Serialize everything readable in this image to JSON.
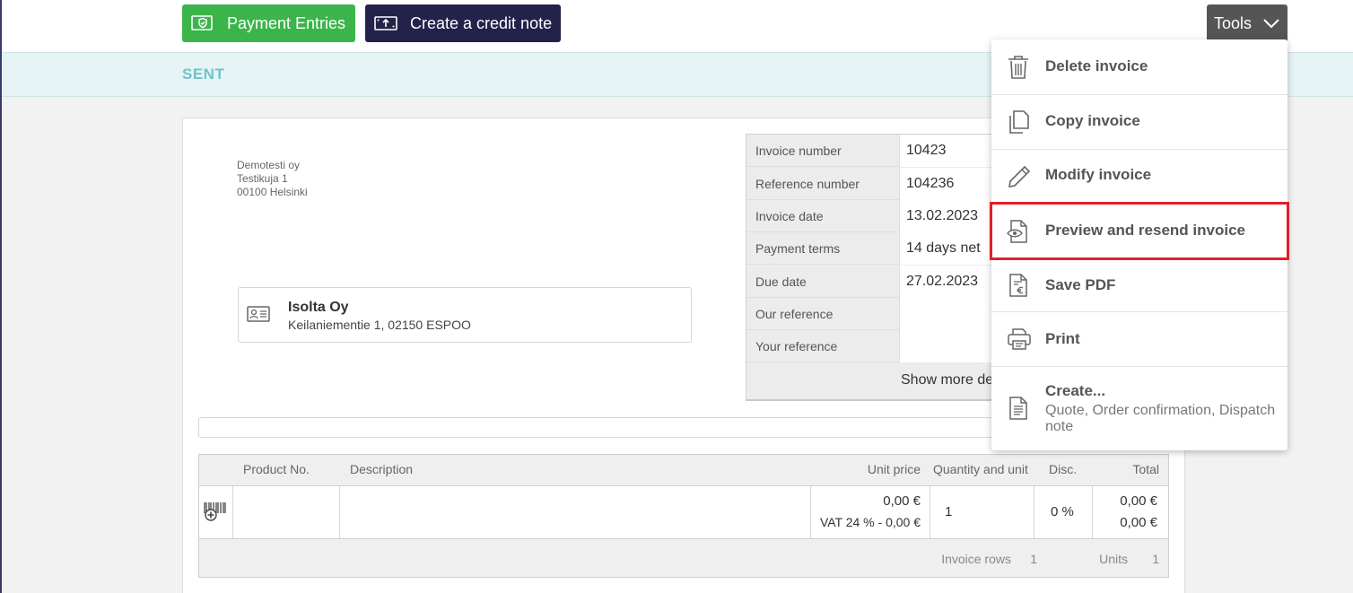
{
  "toolbar": {
    "payment_entries_label": "Payment Entries",
    "credit_note_label": "Create a credit note",
    "tools_label": "Tools"
  },
  "status": {
    "label": "SENT",
    "color": "#6cc4cc"
  },
  "sender": {
    "name": "Demotesti oy",
    "street": "Testikuja 1",
    "city": "00100 Helsinki"
  },
  "recipient": {
    "name": "Isolta Oy",
    "address": "Keilaniementie 1, 02150 ESPOO"
  },
  "invoice_meta": {
    "rows": [
      {
        "label": "Invoice number",
        "value": "10423"
      },
      {
        "label": "Reference number",
        "value": "104236"
      },
      {
        "label": "Invoice date",
        "value": "13.02.2023"
      },
      {
        "label": "Payment terms",
        "value": "14 days net"
      },
      {
        "label": "Due date",
        "value": "27.02.2023"
      },
      {
        "label": "Our reference",
        "value": ""
      },
      {
        "label": "Your reference",
        "value": ""
      }
    ],
    "show_more_label": "Show more de"
  },
  "rows_table": {
    "headers": {
      "product_no": "Product No.",
      "description": "Description",
      "unit_price": "Unit price",
      "quantity": "Quantity and unit",
      "disc": "Disc.",
      "total": "Total"
    },
    "row": {
      "unit_price": "0,00 €",
      "vat_line": "VAT 24 % - 0,00 €",
      "quantity": "1",
      "disc": "0 %",
      "total": "0,00 €",
      "total_vat": "0,00 €"
    },
    "footer": {
      "rows_label": "Invoice rows",
      "rows_count": "1",
      "units_label": "Units",
      "units_count": "1"
    }
  },
  "tools_menu": {
    "items": [
      {
        "label": "Delete invoice",
        "icon": "trash-icon"
      },
      {
        "label": "Copy invoice",
        "icon": "copy-icon"
      },
      {
        "label": "Modify invoice",
        "icon": "pencil-icon"
      },
      {
        "label": "Preview and resend invoice",
        "icon": "document-eye-icon"
      },
      {
        "label": "Save PDF",
        "icon": "document-euro-icon"
      },
      {
        "label": "Print",
        "icon": "printer-icon"
      },
      {
        "label": "Create...",
        "icon": "document-list-icon",
        "sublabel": "Quote, Order confirmation, Dispatch note"
      }
    ],
    "highlight_color": "#e0202a"
  },
  "colors": {
    "payment_button": "#3bb54a",
    "credit_button": "#23224a",
    "tools_button": "#555555",
    "status_band": "#e6f4f6"
  }
}
